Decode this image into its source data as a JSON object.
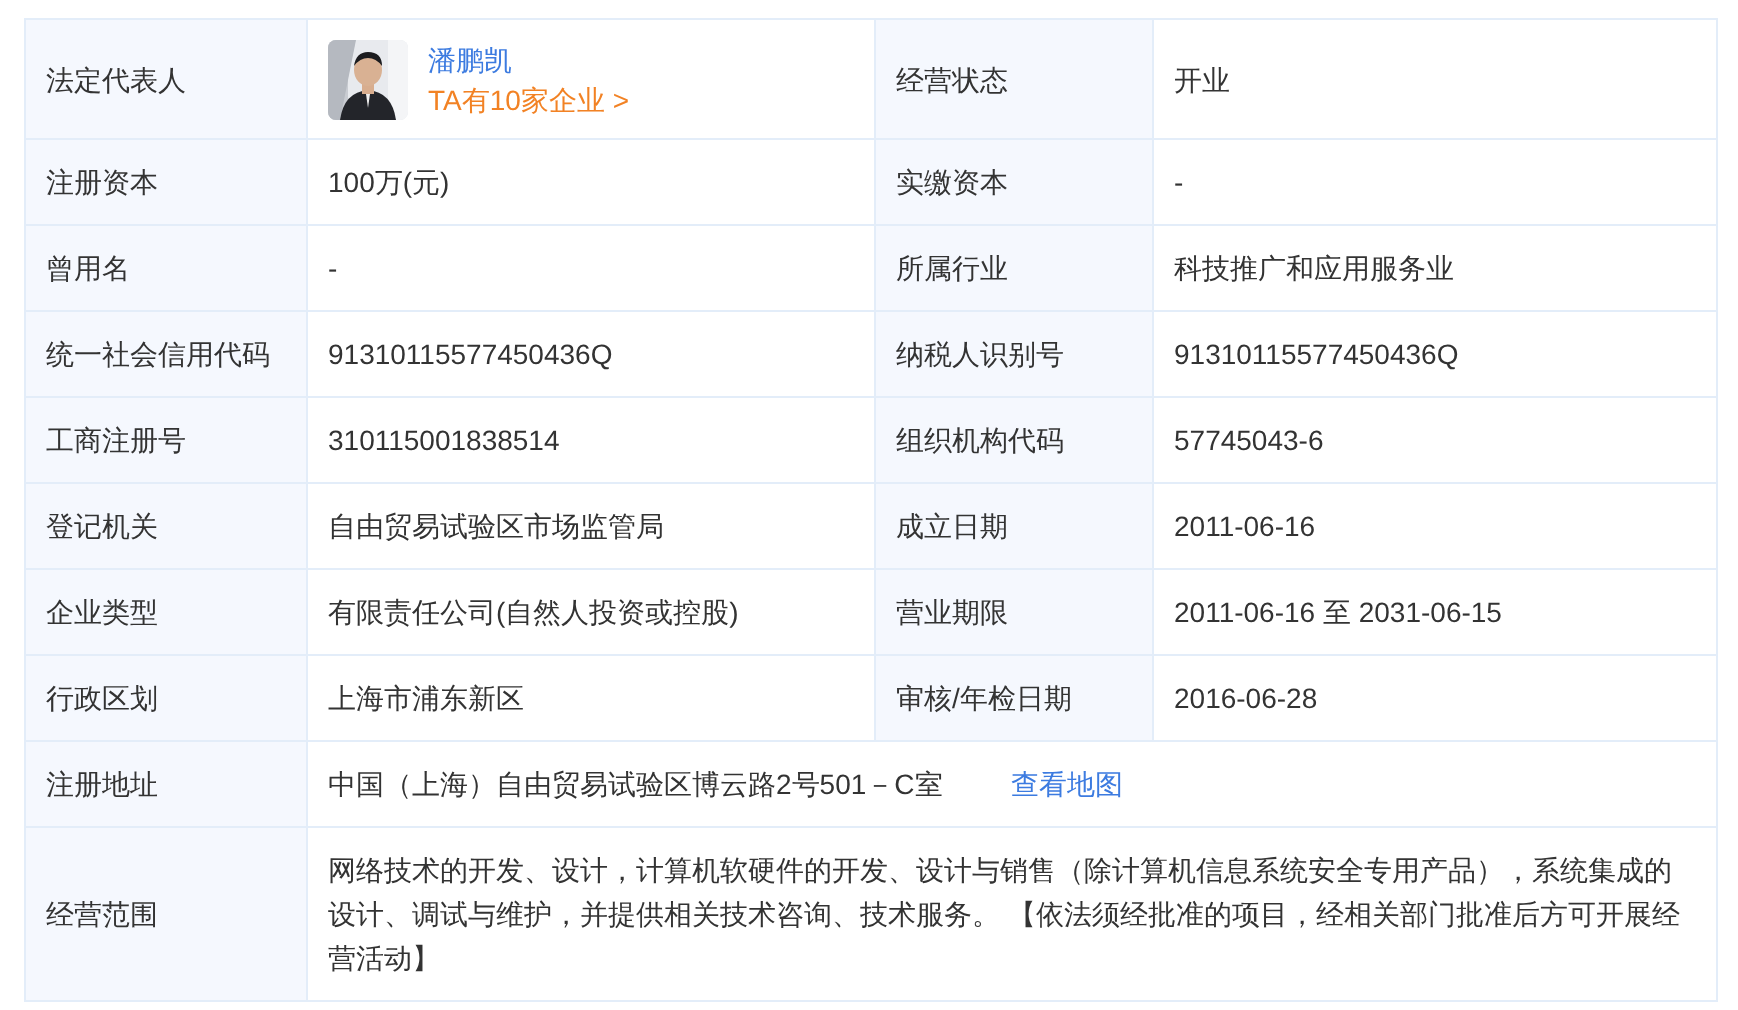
{
  "rows": [
    {
      "cells": [
        {
          "kind": "person",
          "label": "法定代表人",
          "name": "潘鹏凯",
          "link": "TA有10家企业 >"
        },
        {
          "kind": "text",
          "label": "经营状态",
          "value": "开业"
        }
      ]
    },
    {
      "cells": [
        {
          "kind": "text",
          "label": "注册资本",
          "value": "100万(元)"
        },
        {
          "kind": "text",
          "label": "实缴资本",
          "value": "-"
        }
      ]
    },
    {
      "cells": [
        {
          "kind": "text",
          "label": "曾用名",
          "value": "-"
        },
        {
          "kind": "text",
          "label": "所属行业",
          "value": "科技推广和应用服务业"
        }
      ]
    },
    {
      "cells": [
        {
          "kind": "text",
          "label": "统一社会信用代码",
          "value": "91310115577450436Q"
        },
        {
          "kind": "text",
          "label": "纳税人识别号",
          "value": "91310115577450436Q"
        }
      ]
    },
    {
      "cells": [
        {
          "kind": "text",
          "label": "工商注册号",
          "value": "310115001838514"
        },
        {
          "kind": "text",
          "label": "组织机构代码",
          "value": "57745043-6"
        }
      ]
    },
    {
      "cells": [
        {
          "kind": "text",
          "label": "登记机关",
          "value": "自由贸易试验区市场监管局"
        },
        {
          "kind": "text",
          "label": "成立日期",
          "value": "2011-06-16"
        }
      ]
    },
    {
      "cells": [
        {
          "kind": "text",
          "label": "企业类型",
          "value": "有限责任公司(自然人投资或控股)"
        },
        {
          "kind": "text",
          "label": "营业期限",
          "value": "2011-06-16 至 2031-06-15"
        }
      ]
    },
    {
      "cells": [
        {
          "kind": "text",
          "label": "行政区划",
          "value": "上海市浦东新区"
        },
        {
          "kind": "text",
          "label": "审核/年检日期",
          "value": "2016-06-28"
        }
      ]
    },
    {
      "cells": [
        {
          "kind": "address",
          "label": "注册地址",
          "value": "中国（上海）自由贸易试验区博云路2号501－C室",
          "link": "查看地图"
        }
      ]
    },
    {
      "cells": [
        {
          "kind": "text",
          "label": "经营范围",
          "value": "网络技术的开发、设计，计算机软硬件的开发、设计与销售（除计算机信息系统安全专用产品），系统集成的设计、调试与维护，并提供相关技术咨询、技术服务。 【依法须经批准的项目，经相关部门批准后方可开展经营活动】"
        }
      ]
    }
  ]
}
